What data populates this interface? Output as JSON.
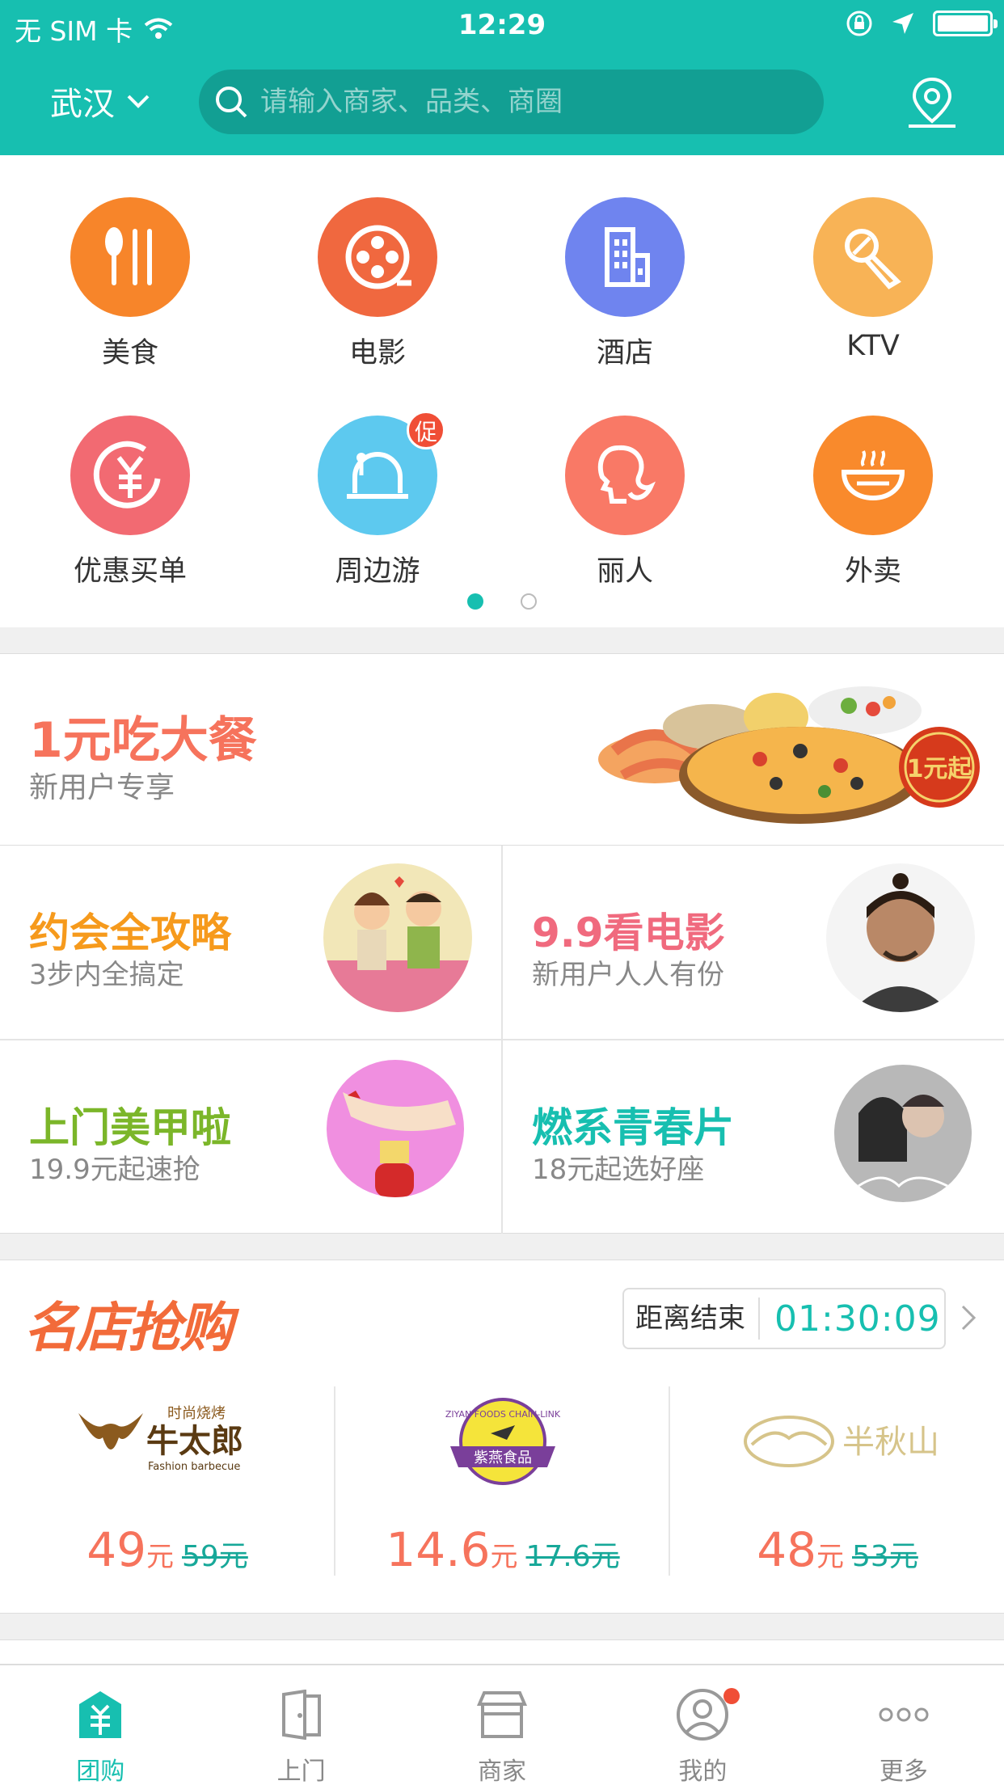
{
  "status_bar": {
    "carrier": "无 SIM 卡",
    "time": "12:29"
  },
  "header": {
    "city": "武汉",
    "search_placeholder": "请输入商家、品类、商圈"
  },
  "categories": [
    {
      "label": "美食",
      "color": "#f7852a",
      "icon": "fork-knife-icon"
    },
    {
      "label": "电影",
      "color": "#f0683f",
      "icon": "film-reel-icon"
    },
    {
      "label": "酒店",
      "color": "#6f84ef",
      "icon": "building-icon"
    },
    {
      "label": "KTV",
      "color": "#f8b356",
      "icon": "microphone-icon"
    },
    {
      "label": "优惠买单",
      "color": "#f26a72",
      "icon": "yen-icon"
    },
    {
      "label": "周边游",
      "color": "#5dc9ef",
      "icon": "tour-icon",
      "badge": "促"
    },
    {
      "label": "丽人",
      "color": "#f97966",
      "icon": "beauty-face-icon"
    },
    {
      "label": "外卖",
      "color": "#f98a2c",
      "icon": "bowl-icon"
    }
  ],
  "banner": {
    "title": "1元吃大餐",
    "subtitle": "新用户专享",
    "stamp": "1元起"
  },
  "promos": [
    {
      "title": "约会全攻略",
      "subtitle": "3步内全搞定",
      "color": "#f69a1c"
    },
    {
      "title": "9.9看电影",
      "subtitle": "新用户人人有份",
      "color": "#f06a7e"
    },
    {
      "title": "上门美甲啦",
      "subtitle": "19.9元起速抢",
      "color": "#7bb629"
    },
    {
      "title": "燃系青春片",
      "subtitle": "18元起选好座",
      "color": "#17bfb0"
    }
  ],
  "flash_sale": {
    "title": "名店抢购",
    "countdown_label": "距离结束",
    "countdown_value": "01:30:09",
    "shops": [
      {
        "price": "49",
        "unit": "元",
        "old_price": "59元",
        "logo_text": "牛太郎",
        "logo_small": "时尚烧烤",
        "logo_en": "Fashion barbecue"
      },
      {
        "price": "14.6",
        "unit": "元",
        "old_price": "17.6元",
        "logo_text": "紫燕食品",
        "logo_en": "ZIYAN FOODS CHAIN-LINK"
      },
      {
        "price": "48",
        "unit": "元",
        "old_price": "53元",
        "logo_text": "半秋山"
      }
    ]
  },
  "tabs": [
    {
      "label": "团购",
      "active": true
    },
    {
      "label": "上门"
    },
    {
      "label": "商家"
    },
    {
      "label": "我的"
    },
    {
      "label": "更多"
    }
  ]
}
